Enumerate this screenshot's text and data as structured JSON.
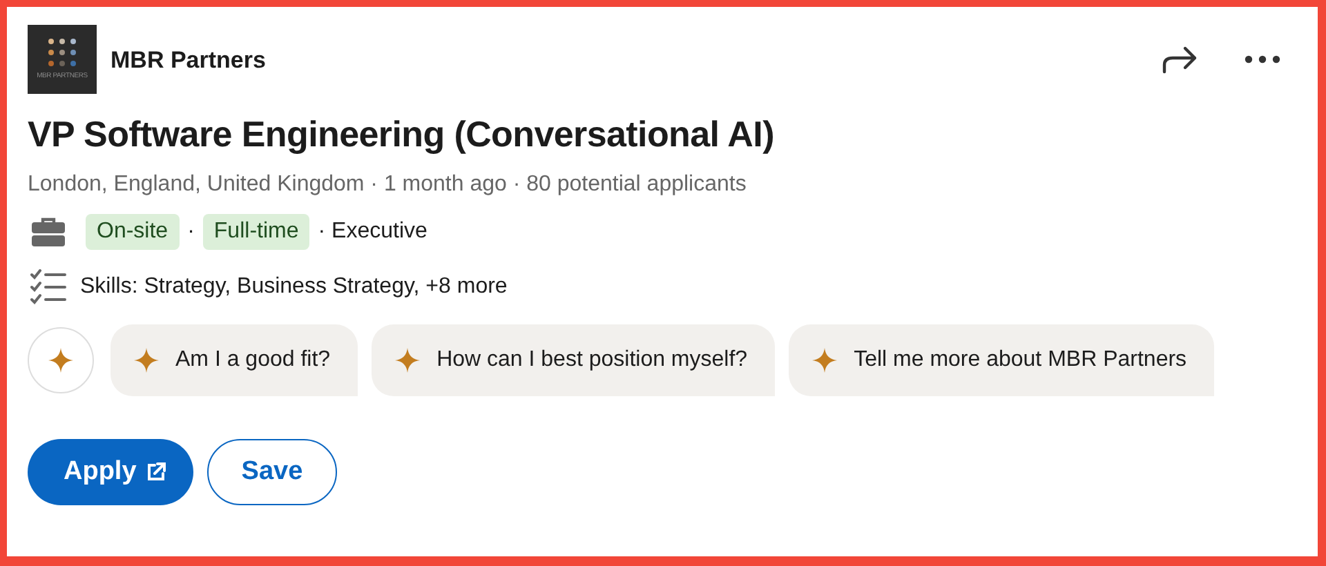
{
  "company": {
    "name": "MBR Partners",
    "logo_text": "MBR PARTNERS"
  },
  "title": "VP Software Engineering (Conversational AI)",
  "meta": "London, England, United Kingdom · 1 month ago · 80 potential applicants",
  "job_type": {
    "tags": [
      "On-site",
      "Full-time"
    ],
    "separator": "·",
    "extra": "· Executive"
  },
  "skills": "Skills: Strategy, Business Strategy, +8 more",
  "prompts": [
    "Am I a good fit?",
    "How can I best position myself?",
    "Tell me more about MBR Partners"
  ],
  "buttons": {
    "apply": "Apply",
    "save": "Save"
  }
}
